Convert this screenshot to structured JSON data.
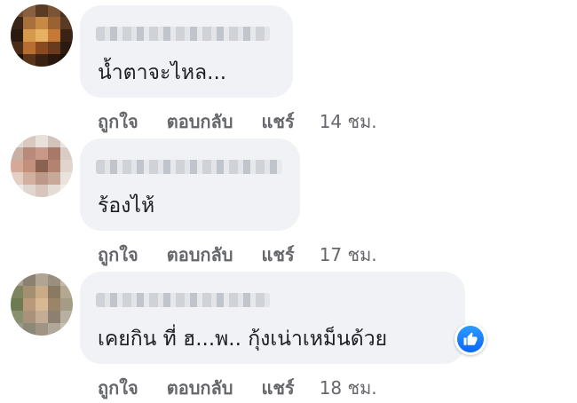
{
  "comments": [
    {
      "text": "น้ำตาจะไหล...",
      "actions": {
        "like": "ถูกใจ",
        "reply": "ตอบกลับ",
        "share": "แชร์",
        "time": "14 ชม."
      }
    },
    {
      "text": "ร้องไห้",
      "actions": {
        "like": "ถูกใจ",
        "reply": "ตอบกลับ",
        "share": "แชร์",
        "time": "17 ชม."
      }
    },
    {
      "text": "เคยกิน ที่ ฮ...พ.. กุ้งเน่าเหม็นด้วย",
      "actions": {
        "like": "ถูกใจ",
        "reply": "ตอบกลับ",
        "share": "แชร์",
        "time": "18 ชม."
      },
      "reaction": "like-icon"
    }
  ],
  "colors": {
    "bubble": "#f0f2f5",
    "text": "#1c1e21",
    "meta": "#65676b",
    "like_blue": "#0866ff"
  }
}
